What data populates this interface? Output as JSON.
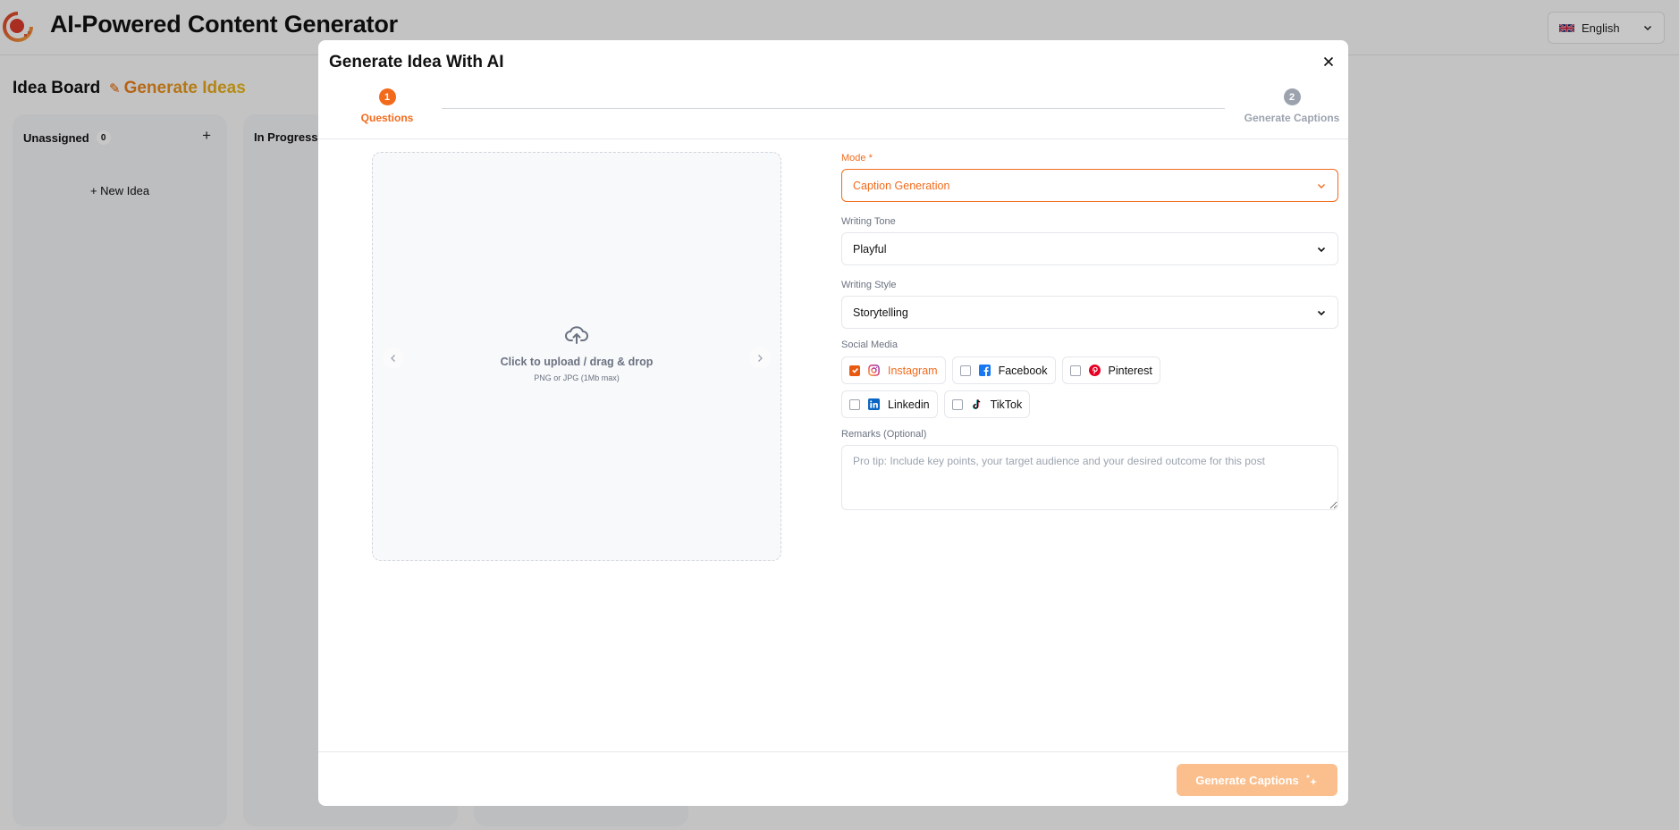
{
  "app": {
    "title": "AI-Powered Content Generator",
    "language": {
      "selected": "English",
      "flag": "uk-flag"
    }
  },
  "board": {
    "title": "Idea Board",
    "generate_ideas_label": "Generate Ideas",
    "columns": [
      {
        "title": "Unassigned",
        "count": "0",
        "new_idea_label": "+ New Idea"
      },
      {
        "title": "In Progress"
      },
      {
        "title": ""
      }
    ]
  },
  "modal": {
    "title": "Generate Idea With AI",
    "steps": [
      {
        "number": "1",
        "label": "Questions",
        "state": "active"
      },
      {
        "number": "2",
        "label": "Generate Captions",
        "state": "inactive"
      }
    ],
    "upload": {
      "text": "Click to upload / drag & drop",
      "hint": "PNG or JPG (1Mb max)"
    },
    "form": {
      "mode": {
        "label": "Mode *",
        "value": "Caption Generation"
      },
      "writing_tone": {
        "label": "Writing Tone",
        "value": "Playful"
      },
      "writing_style": {
        "label": "Writing Style",
        "value": "Storytelling"
      },
      "social_media": {
        "label": "Social Media",
        "options": [
          {
            "name": "Instagram",
            "checked": true,
            "icon": "instagram-icon"
          },
          {
            "name": "Facebook",
            "checked": false,
            "icon": "facebook-icon"
          },
          {
            "name": "Pinterest",
            "checked": false,
            "icon": "pinterest-icon"
          },
          {
            "name": "Linkedin",
            "checked": false,
            "icon": "linkedin-icon"
          },
          {
            "name": "TikTok",
            "checked": false,
            "icon": "tiktok-icon"
          }
        ]
      },
      "remarks": {
        "label": "Remarks (Optional)",
        "value": "",
        "placeholder": "Pro tip: Include key points, your target audience and your desired outcome for this post"
      }
    },
    "submit_label": "Generate Captions"
  },
  "colors": {
    "accent": "#f26b1d",
    "accent_disabled": "#fbbf8d",
    "inactive": "#9ca3af"
  }
}
